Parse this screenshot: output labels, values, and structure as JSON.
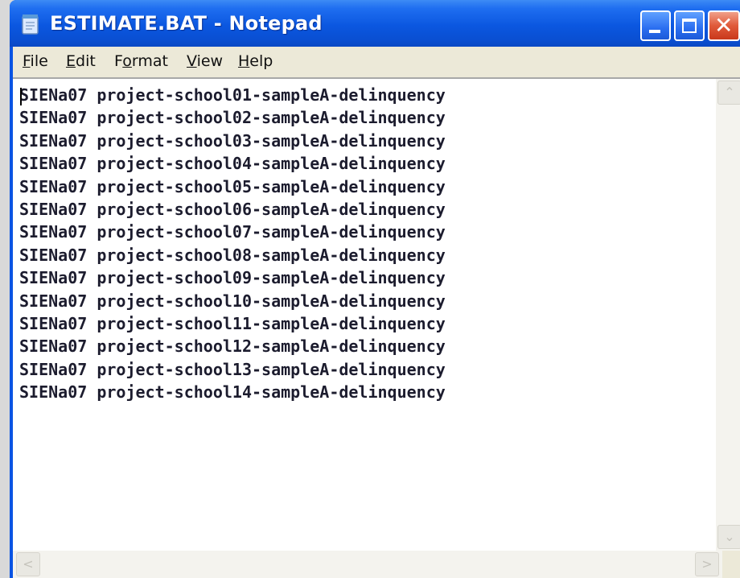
{
  "window": {
    "title": "ESTIMATE.BAT - Notepad",
    "icon": "notepad-icon",
    "controls": {
      "minimize": "minimize-icon",
      "maximize": "maximize-icon",
      "close": "close-icon",
      "close_glyph": "✕"
    }
  },
  "menu": {
    "file": {
      "accel": "F",
      "rest": "ile"
    },
    "edit": {
      "accel": "E",
      "rest": "dit"
    },
    "format": {
      "pre": "F",
      "accel": "o",
      "rest": "rmat"
    },
    "view": {
      "accel": "V",
      "rest": "iew"
    },
    "help": {
      "accel": "H",
      "rest": "elp"
    }
  },
  "document": {
    "lines": [
      "SIENa07 project-school01-sampleA-delinquency",
      "SIENa07 project-school02-sampleA-delinquency",
      "SIENa07 project-school03-sampleA-delinquency",
      "SIENa07 project-school04-sampleA-delinquency",
      "SIENa07 project-school05-sampleA-delinquency",
      "SIENa07 project-school06-sampleA-delinquency",
      "SIENa07 project-school07-sampleA-delinquency",
      "SIENa07 project-school08-sampleA-delinquency",
      "SIENa07 project-school09-sampleA-delinquency",
      "SIENa07 project-school10-sampleA-delinquency",
      "SIENa07 project-school11-sampleA-delinquency",
      "SIENa07 project-school12-sampleA-delinquency",
      "SIENa07 project-school13-sampleA-delinquency",
      "SIENa07 project-school14-sampleA-delinquency"
    ]
  },
  "scrollbars": {
    "up": "⌃",
    "down": "⌄",
    "left": "<",
    "right": ">"
  },
  "colors": {
    "titlebar": "#0a54e3",
    "menubar": "#ece9d8",
    "text": "#1c1c2e"
  }
}
